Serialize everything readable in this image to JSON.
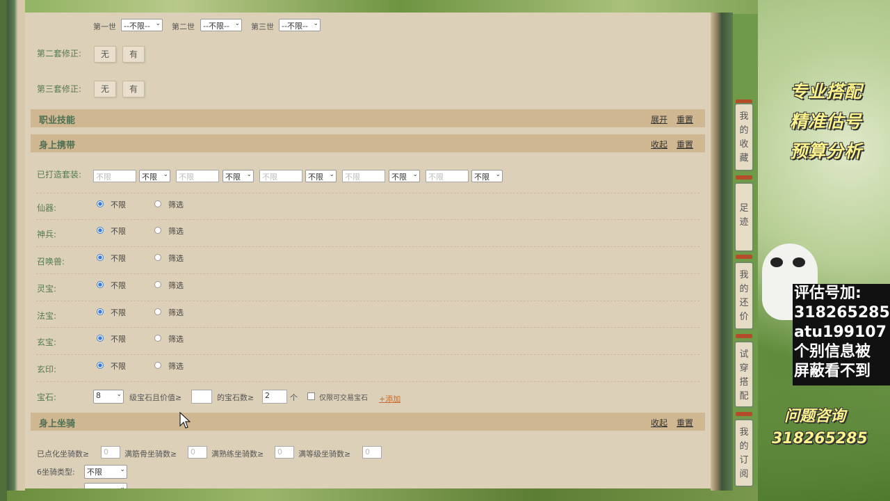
{
  "equip_gen": {
    "gen1_label": "第一世",
    "gen1_value": "--不限--",
    "gen2_label": "第二世",
    "gen2_value": "--不限--",
    "gen3_label": "第三世",
    "gen3_value": "--不限--"
  },
  "fix2": {
    "label": "第二套修正:",
    "no": "无",
    "yes": "有"
  },
  "fix3": {
    "label": "第三套修正:",
    "no": "无",
    "yes": "有"
  },
  "skills_section": {
    "title": "职业技能",
    "expand": "展开",
    "reset": "重置"
  },
  "carry_section": {
    "title": "身上携带",
    "collapse": "收起",
    "reset": "重置"
  },
  "forged_sets": {
    "label": "已打造套装:",
    "placeholder": "不限",
    "select_value": "不限"
  },
  "carry_rows": [
    {
      "label": "仙器:",
      "opt_any": "不限",
      "opt_filter": "筛选"
    },
    {
      "label": "神兵:",
      "opt_any": "不限",
      "opt_filter": "筛选"
    },
    {
      "label": "召唤兽:",
      "opt_any": "不限",
      "opt_filter": "筛选"
    },
    {
      "label": "灵宝:",
      "opt_any": "不限",
      "opt_filter": "筛选"
    },
    {
      "label": "法宝:",
      "opt_any": "不限",
      "opt_filter": "筛选"
    },
    {
      "label": "玄宝:",
      "opt_any": "不限",
      "opt_filter": "筛选"
    },
    {
      "label": "玄印:",
      "opt_any": "不限",
      "opt_filter": "筛选"
    }
  ],
  "gem": {
    "label": "宝石:",
    "level_value": "8",
    "text1": "级宝石且价值≥",
    "value_input": "",
    "text2": "的宝石数≥",
    "count_value": "2",
    "unit": "个",
    "tradable_label": "仅限可交易宝石",
    "add_link": "+添加"
  },
  "mount_section": {
    "title": "身上坐骑",
    "collapse": "收起",
    "reset": "重置"
  },
  "mount_row": {
    "dotted_label": "已点化坐骑数≥",
    "dotted_value": "0",
    "bones_label": "满筋骨坐骑数≥",
    "bones_value": "0",
    "skill_label": "满熟练坐骑数≥",
    "skill_value": "0",
    "level_label": "满等级坐骑数≥",
    "level_value": "0"
  },
  "mount6": {
    "label": "6坐骑类型:",
    "value": "不限"
  },
  "side_tabs": [
    {
      "label": "我的收藏"
    },
    {
      "label": "足迹"
    },
    {
      "label": "我的还价"
    },
    {
      "label": "试穿搭配"
    },
    {
      "label": "我的订阅"
    }
  ],
  "promo": {
    "line1": "专业搭配",
    "line2": "精准估号",
    "line3": "预算分析"
  },
  "info": {
    "line1": "评估号加:",
    "line2": "318265285",
    "line3": "atu199107",
    "line4": "个别信息被",
    "line5": "屏蔽看不到"
  },
  "consult": {
    "title": "问题咨询",
    "number": "318265285"
  }
}
